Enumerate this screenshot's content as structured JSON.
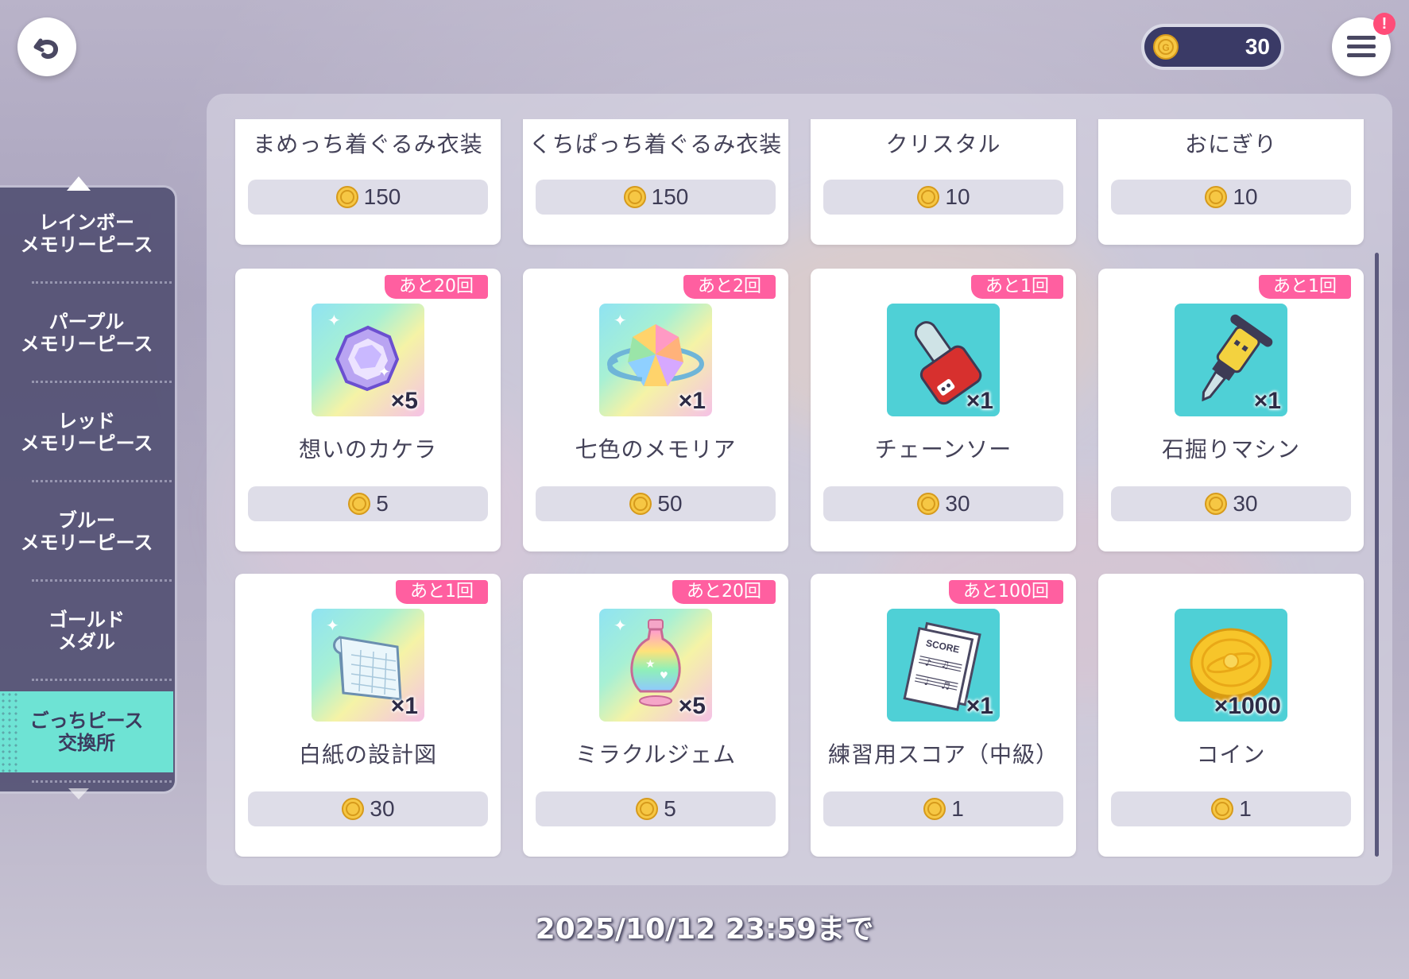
{
  "header": {
    "coin_count": "30",
    "menu_alert": "!"
  },
  "sidebar": {
    "items": [
      {
        "label": "レインボー\nメモリーピース",
        "active": false
      },
      {
        "label": "パープル\nメモリーピース",
        "active": false
      },
      {
        "label": "レッド\nメモリーピース",
        "active": false
      },
      {
        "label": "ブルー\nメモリーピース",
        "active": false
      },
      {
        "label": "ゴールド\nメダル",
        "active": false
      },
      {
        "label": "ごっちピース\n交換所",
        "active": true
      }
    ]
  },
  "shop": {
    "top_row": [
      {
        "name": "まめっち着ぐるみ衣装",
        "price": "150"
      },
      {
        "name": "くちぱっち着ぐるみ衣装",
        "price": "150"
      },
      {
        "name": "クリスタル",
        "price": "10"
      },
      {
        "name": "おにぎり",
        "price": "10"
      }
    ],
    "items": [
      {
        "name": "想いのカケラ",
        "price": "5",
        "badge": "あと20回",
        "qty": "×5",
        "icon": "crystal-gem-icon"
      },
      {
        "name": "七色のメモリア",
        "price": "50",
        "badge": "あと2回",
        "qty": "×1",
        "icon": "rainbow-gem-icon"
      },
      {
        "name": "チェーンソー",
        "price": "30",
        "badge": "あと1回",
        "qty": "×1",
        "icon": "chainsaw-icon"
      },
      {
        "name": "石掘りマシン",
        "price": "30",
        "badge": "あと1回",
        "qty": "×1",
        "icon": "jackhammer-icon"
      },
      {
        "name": "白紙の設計図",
        "price": "30",
        "badge": "あと1回",
        "qty": "×1",
        "icon": "blueprint-icon"
      },
      {
        "name": "ミラクルジェム",
        "price": "5",
        "badge": "あと20回",
        "qty": "×5",
        "icon": "potion-bottle-icon"
      },
      {
        "name": "練習用スコア（中級）",
        "price": "1",
        "badge": "あと100回",
        "qty": "×1",
        "icon": "score-sheet-icon"
      },
      {
        "name": "コイン",
        "price": "1",
        "badge": "",
        "qty": "×1000",
        "icon": "gold-coin-icon"
      }
    ]
  },
  "score_label": "SCORE",
  "deadline": "2025/10/12 23:59まで",
  "colors": {
    "badge": "#ff5fa0",
    "active_tab": "#6ee3d4",
    "sidebar": "#4e4c70",
    "price_pill": "#dedde8"
  }
}
